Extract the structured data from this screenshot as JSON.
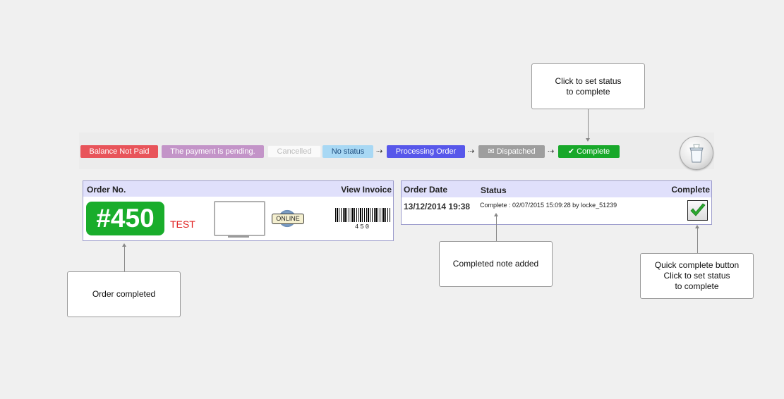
{
  "status_bar": {
    "balance": "Balance Not Paid",
    "payment": "The payment is pending.",
    "cancelled": "Cancelled",
    "no_status": "No status",
    "arrow": "⇢",
    "processing": "Processing Order",
    "dispatched": "Dispatched",
    "complete": "Complete",
    "envelope_icon": "✉",
    "check_icon": "✔",
    "colors": {
      "balance": "#e8545a",
      "payment": "#c394c8",
      "no_status": "#a8d8f4",
      "processing": "#5757ea",
      "dispatched": "#9e9e9e",
      "complete": "#18a82a"
    }
  },
  "order_panel": {
    "order_no_header": "Order No.",
    "view_invoice_header": "View Invoice",
    "order_number": "#450",
    "test_label": "TEST",
    "online_label": "ONLINE",
    "barcode_number": "450"
  },
  "status_panel": {
    "order_date_header": "Order Date",
    "status_header": "Status",
    "complete_header": "Complete",
    "order_date": "13/12/2014 19:38",
    "status_note": "Complete : 02/07/2015 15:09:28 by locke_51239",
    "check_icon": "✔"
  },
  "callouts": {
    "set_status_line1": "Click to set status",
    "set_status_line2": "to complete",
    "order_completed": "Order completed",
    "note_added": "Completed note added",
    "quick_line1": "Quick complete button",
    "quick_line2": "Click to set status",
    "quick_line3": "to complete"
  }
}
